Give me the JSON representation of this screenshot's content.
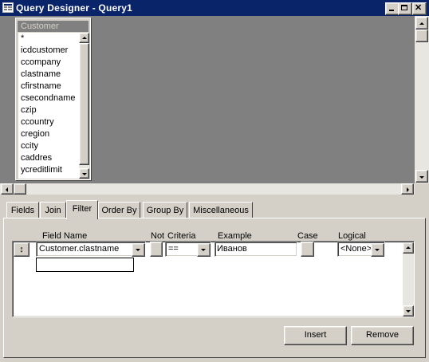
{
  "window": {
    "title": "Query Designer - Query1",
    "controls": [
      "minimize",
      "maximize",
      "close"
    ]
  },
  "table_box": {
    "title": "Customer",
    "fields": [
      "*",
      "icdcustomer",
      "ccompany",
      "clastname",
      "cfirstname",
      "csecondname",
      "czip",
      "ccountry",
      "cregion",
      "ccity",
      "caddres",
      "ycreditlimit"
    ]
  },
  "tabs": [
    {
      "label": "Fields",
      "active": false
    },
    {
      "label": "Join",
      "active": false
    },
    {
      "label": "Filter",
      "active": true
    },
    {
      "label": "Order By",
      "active": false
    },
    {
      "label": "Group By",
      "active": false
    },
    {
      "label": "Miscellaneous",
      "active": false
    }
  ],
  "filter": {
    "columns": {
      "field_name": "Field Name",
      "not": "Not",
      "criteria": "Criteria",
      "example": "Example",
      "case": "Case",
      "logical": "Logical"
    },
    "row": {
      "mover": "↕",
      "field_name": "Customer.clastname",
      "criteria": "==",
      "example": "Иванов",
      "logical": "<None>"
    }
  },
  "buttons": {
    "insert": "Insert",
    "remove": "Remove"
  }
}
